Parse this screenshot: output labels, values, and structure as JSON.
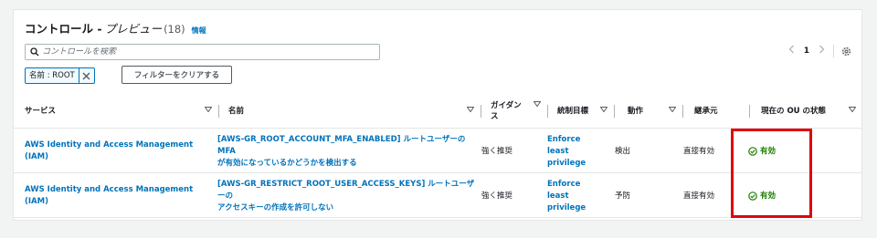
{
  "header": {
    "title": "コントロール -",
    "subtitle": "プレビュー",
    "count": "(18)",
    "info_link": "情報"
  },
  "search": {
    "placeholder": "コントロールを検索"
  },
  "filter_token": {
    "label": "名前 : ROOT"
  },
  "clear_filters_label": "フィルターをクリアする",
  "pagination": {
    "current_page": "1"
  },
  "columns": [
    "サービス",
    "名前",
    "ガイダンス",
    "統制目標",
    "動作",
    "継承元",
    "現在の OU の状態"
  ],
  "rows": [
    {
      "service": "AWS Identity and Access Management (IAM)",
      "name_line1": "[AWS-GR_ROOT_ACCOUNT_MFA_ENABLED] ルートユーザーの MFA",
      "name_line2": "が有効になっているかどうかを検出する",
      "guidance": "強く推奨",
      "objective_line1": "Enforce",
      "objective_line2": "least",
      "objective_line3": "privilege",
      "behavior": "検出",
      "inherited_from": "直接有効",
      "ou_state": "有効"
    },
    {
      "service": "AWS Identity and Access Management (IAM)",
      "name_line1": "[AWS-GR_RESTRICT_ROOT_USER_ACCESS_KEYS] ルートユーザーの",
      "name_line2": "アクセスキーの作成を許可しない",
      "guidance": "強く推奨",
      "objective_line1": "Enforce",
      "objective_line2": "least",
      "objective_line3": "privilege",
      "behavior": "予防",
      "inherited_from": "直接有効",
      "ou_state": "有効"
    }
  ],
  "colors": {
    "link": "#0073bb",
    "success": "#1d8102",
    "highlight": "#e0040b"
  },
  "icons": [
    "search-icon",
    "close-icon",
    "chevron-left-icon",
    "chevron-right-icon",
    "gear-icon",
    "caret-down-icon",
    "check-circle-icon"
  ]
}
